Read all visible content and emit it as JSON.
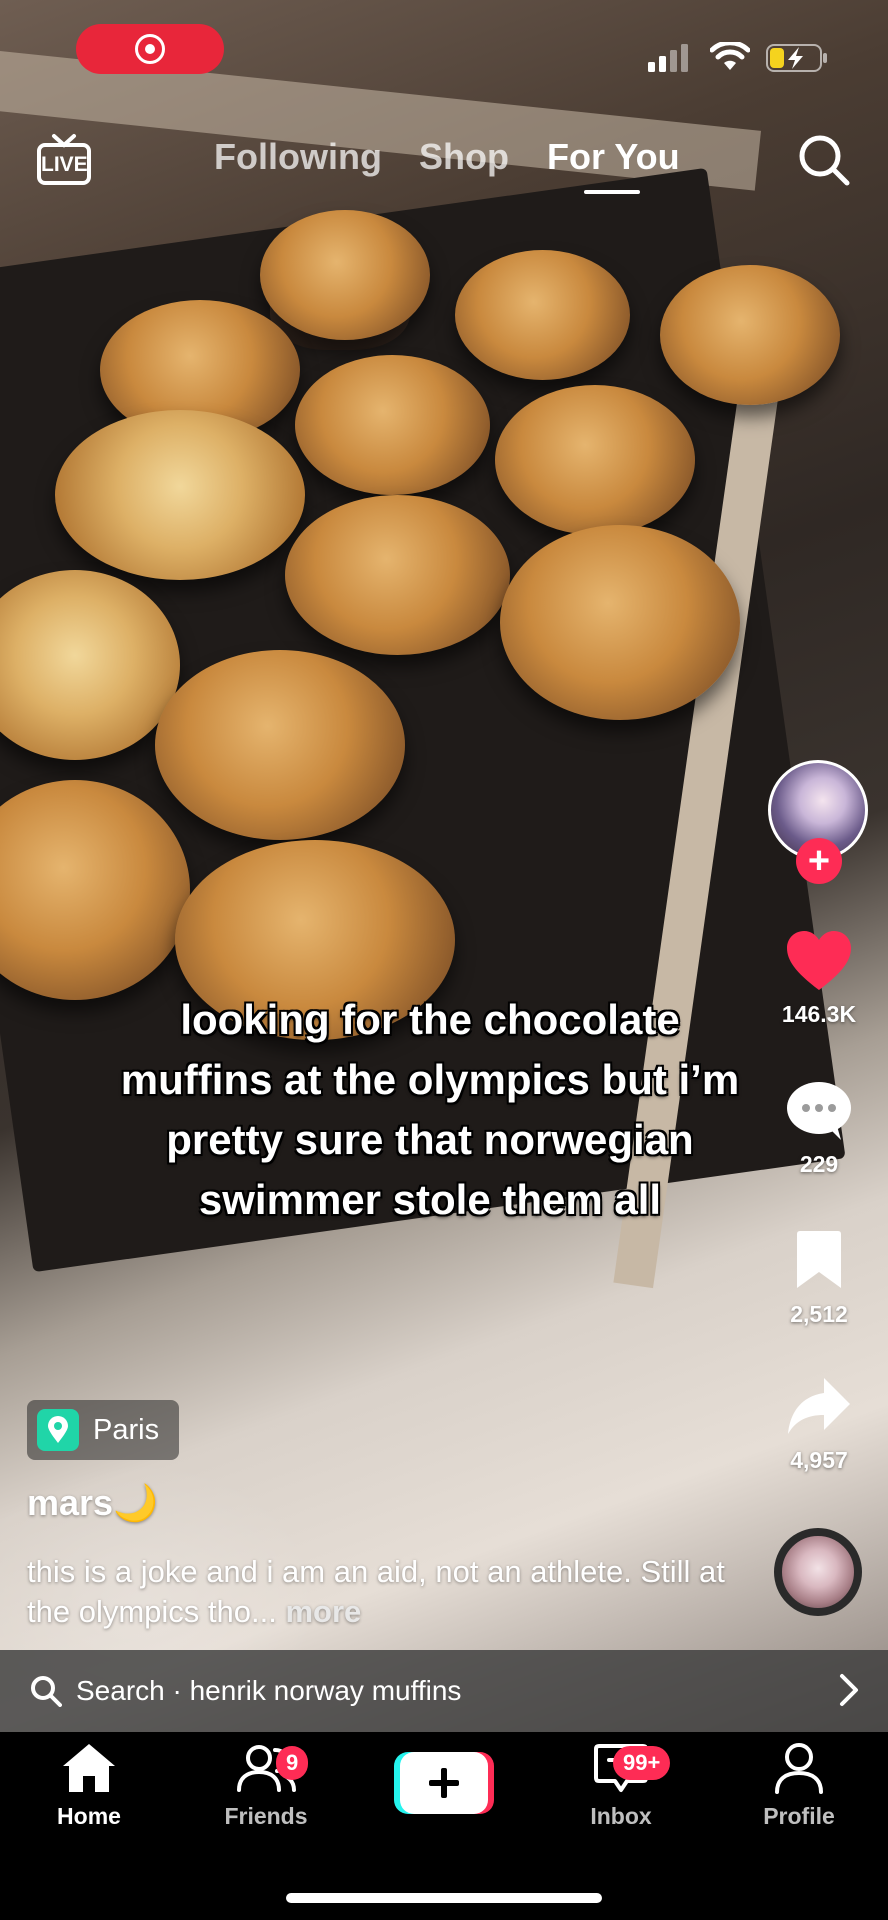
{
  "status_bar": {
    "recording_icon": "record-icon",
    "signal_icon": "signal-bars-icon",
    "wifi_icon": "wifi-icon",
    "battery_icon": "battery-charging-icon"
  },
  "top_nav": {
    "live_label": "LIVE",
    "tabs": [
      {
        "label": "Following"
      },
      {
        "label": "Shop"
      },
      {
        "label": "For You"
      }
    ],
    "active_tab": "For You"
  },
  "caption": "looking for the chocolate muffins at the olympics but i’m pretty sure that norwegian swimmer stole them all",
  "actions": {
    "likes": "146.3K",
    "comments": "229",
    "saves": "2,512",
    "shares": "4,957"
  },
  "post": {
    "location": "Paris",
    "username": "mars",
    "username_emoji": "🌙",
    "description": "this is a joke and i am an aid, not an athlete. Still at the olympics tho...",
    "more_label": "more"
  },
  "search_suggestion": {
    "prefix": "Search",
    "separator": " · ",
    "query": "henrik norway muffins"
  },
  "tabbar": {
    "items": [
      {
        "label": "Home",
        "icon": "home-icon"
      },
      {
        "label": "Friends",
        "icon": "friends-icon",
        "badge": "9"
      },
      {
        "label": "",
        "icon": "create-plus-icon"
      },
      {
        "label": "Inbox",
        "icon": "inbox-icon",
        "badge": "99+"
      },
      {
        "label": "Profile",
        "icon": "profile-icon"
      }
    ],
    "active": "Home"
  },
  "colors": {
    "accent": "#fe2c55",
    "location_pin": "#20d5a8",
    "recording": "#e8263a"
  }
}
